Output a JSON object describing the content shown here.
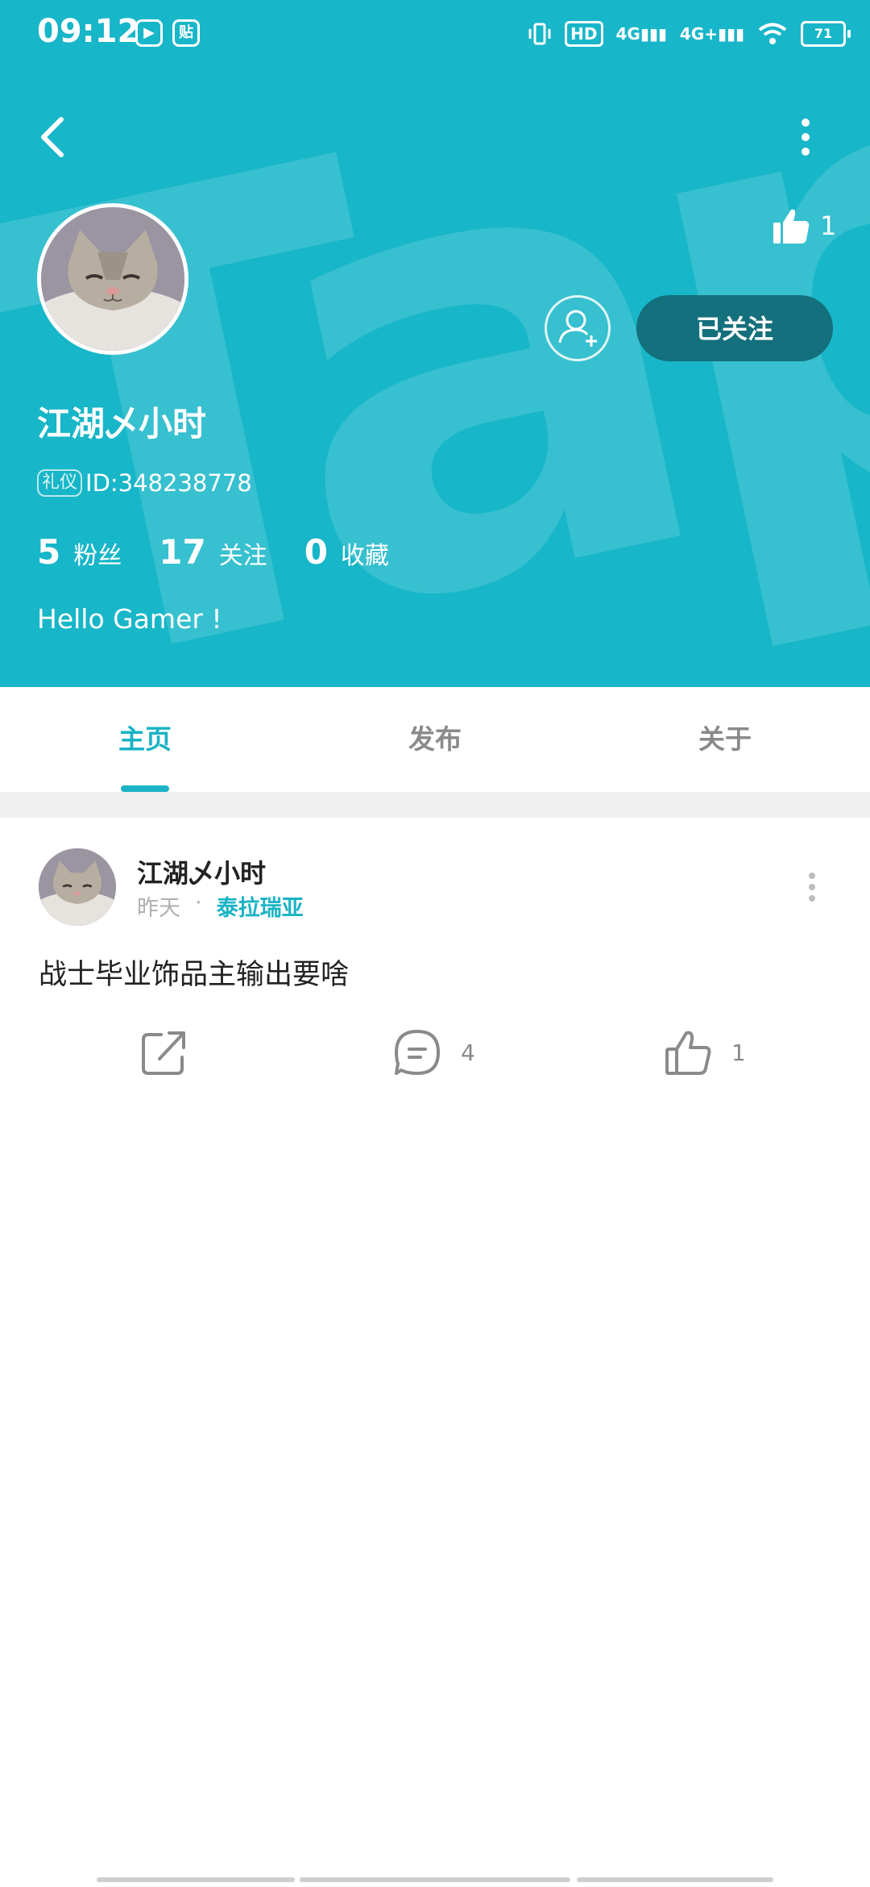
{
  "status_bar": {
    "time": "09:12",
    "app_icon_1": "play-icon",
    "app_icon_2": "贴",
    "hd_label": "HD",
    "sim1_label": "4G",
    "sim2_label": "4G+",
    "battery": "71"
  },
  "profile": {
    "like_count": "1",
    "follow_label": "已关注",
    "username": "江湖乄小时",
    "tag": "礼仪",
    "id_text": "ID:348238778",
    "stats": [
      {
        "num": "5",
        "label": "粉丝"
      },
      {
        "num": "17",
        "label": "关注"
      },
      {
        "num": "0",
        "label": "收藏"
      }
    ],
    "bio": "Hello Gamer !"
  },
  "tabs": [
    {
      "label": "主页",
      "active": true
    },
    {
      "label": "发布",
      "active": false
    },
    {
      "label": "关于",
      "active": false
    }
  ],
  "post": {
    "username": "江湖乄小时",
    "time": "昨天",
    "separator": "·",
    "server": "泰拉瑞亚",
    "text": "战士毕业饰品主输出要啥",
    "comment_count": "4",
    "like_count": "1"
  },
  "colors": {
    "accent": "#1ab3c4",
    "header_bg": "#17b6c8",
    "follow_btn": "#13707c"
  }
}
